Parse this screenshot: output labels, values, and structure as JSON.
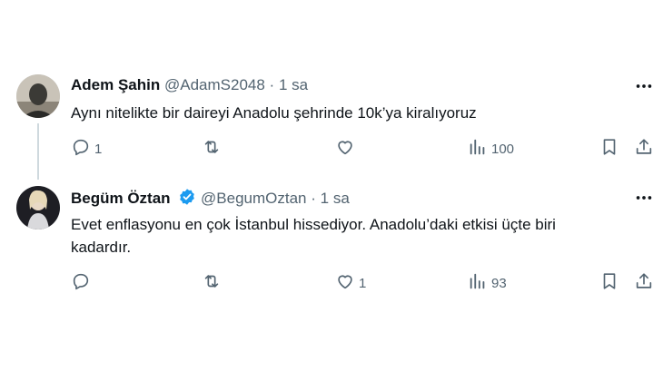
{
  "tweets": [
    {
      "name": "Adem Şahin",
      "handle": "@AdamS2048",
      "separator": "·",
      "time": "1 sa",
      "verified": false,
      "text": "Aynı nitelikte bir daireyi Anadolu şehrinde 10k’ya kiralıyoruz",
      "replies": "1",
      "retweets": "",
      "likes": "",
      "views": "100"
    },
    {
      "name": "Begüm Öztan",
      "handle": "@BegumOztan",
      "separator": "·",
      "time": "1 sa",
      "verified": true,
      "text": "Evet enflasyonu en çok İstanbul hissediyor. Anadolu’daki etkisi üçte biri kadardır.",
      "replies": "",
      "retweets": "",
      "likes": "1",
      "views": "93"
    }
  ],
  "colors": {
    "text": "#0f1419",
    "muted": "#536471",
    "verified": "#1d9bf0",
    "thread_line": "#cfd9de"
  },
  "icons": [
    "reply-icon",
    "retweet-icon",
    "like-icon",
    "views-icon",
    "bookmark-icon",
    "share-icon",
    "more-icon",
    "verified-badge-icon"
  ]
}
